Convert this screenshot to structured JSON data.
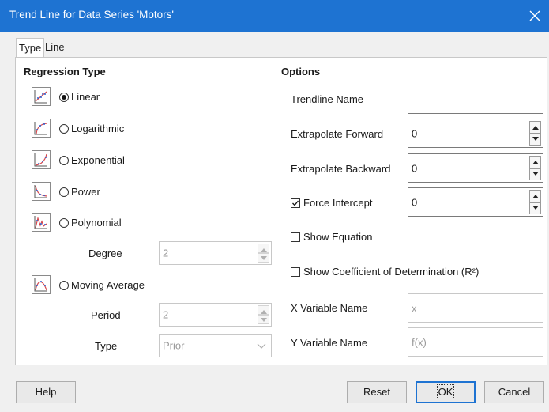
{
  "window": {
    "title": "Trend Line for Data Series 'Motors'"
  },
  "tabs": [
    {
      "label": "Type"
    },
    {
      "label": "Line"
    }
  ],
  "regression": {
    "heading": "Regression Type",
    "linear": {
      "label": "Linear",
      "selected": true
    },
    "logarithmic": {
      "label": "Logarithmic"
    },
    "exponential": {
      "label": "Exponential"
    },
    "power": {
      "label": "Power"
    },
    "polynomial": {
      "label": "Polynomial"
    },
    "degree": {
      "label": "Degree",
      "value": "2"
    },
    "moving_average": {
      "label": "Moving Average"
    },
    "period": {
      "label": "Period",
      "value": "2"
    },
    "type": {
      "label": "Type",
      "value": "Prior"
    }
  },
  "options": {
    "heading": "Options",
    "trendline_name": {
      "label": "Trendline Name",
      "value": ""
    },
    "extrapolate_forward": {
      "label": "Extrapolate Forward",
      "value": "0"
    },
    "extrapolate_backward": {
      "label": "Extrapolate Backward",
      "value": "0"
    },
    "force_intercept": {
      "label": "Force Intercept",
      "checked": true,
      "value": "0"
    },
    "show_equation": {
      "label": "Show Equation",
      "checked": false
    },
    "show_coefficient": {
      "label": "Show Coefficient of Determination (R²)",
      "checked": false
    },
    "x_variable_name": {
      "label": "X Variable Name",
      "value": "x"
    },
    "y_variable_name": {
      "label": "Y Variable Name",
      "value": "f(x)"
    }
  },
  "buttons": {
    "help": "Help",
    "reset": "Reset",
    "ok": "OK",
    "cancel": "Cancel"
  },
  "colors": {
    "title_bar": "#1e73d2",
    "icon_line": "#d6484f",
    "icon_points": "#2f5fd0"
  }
}
